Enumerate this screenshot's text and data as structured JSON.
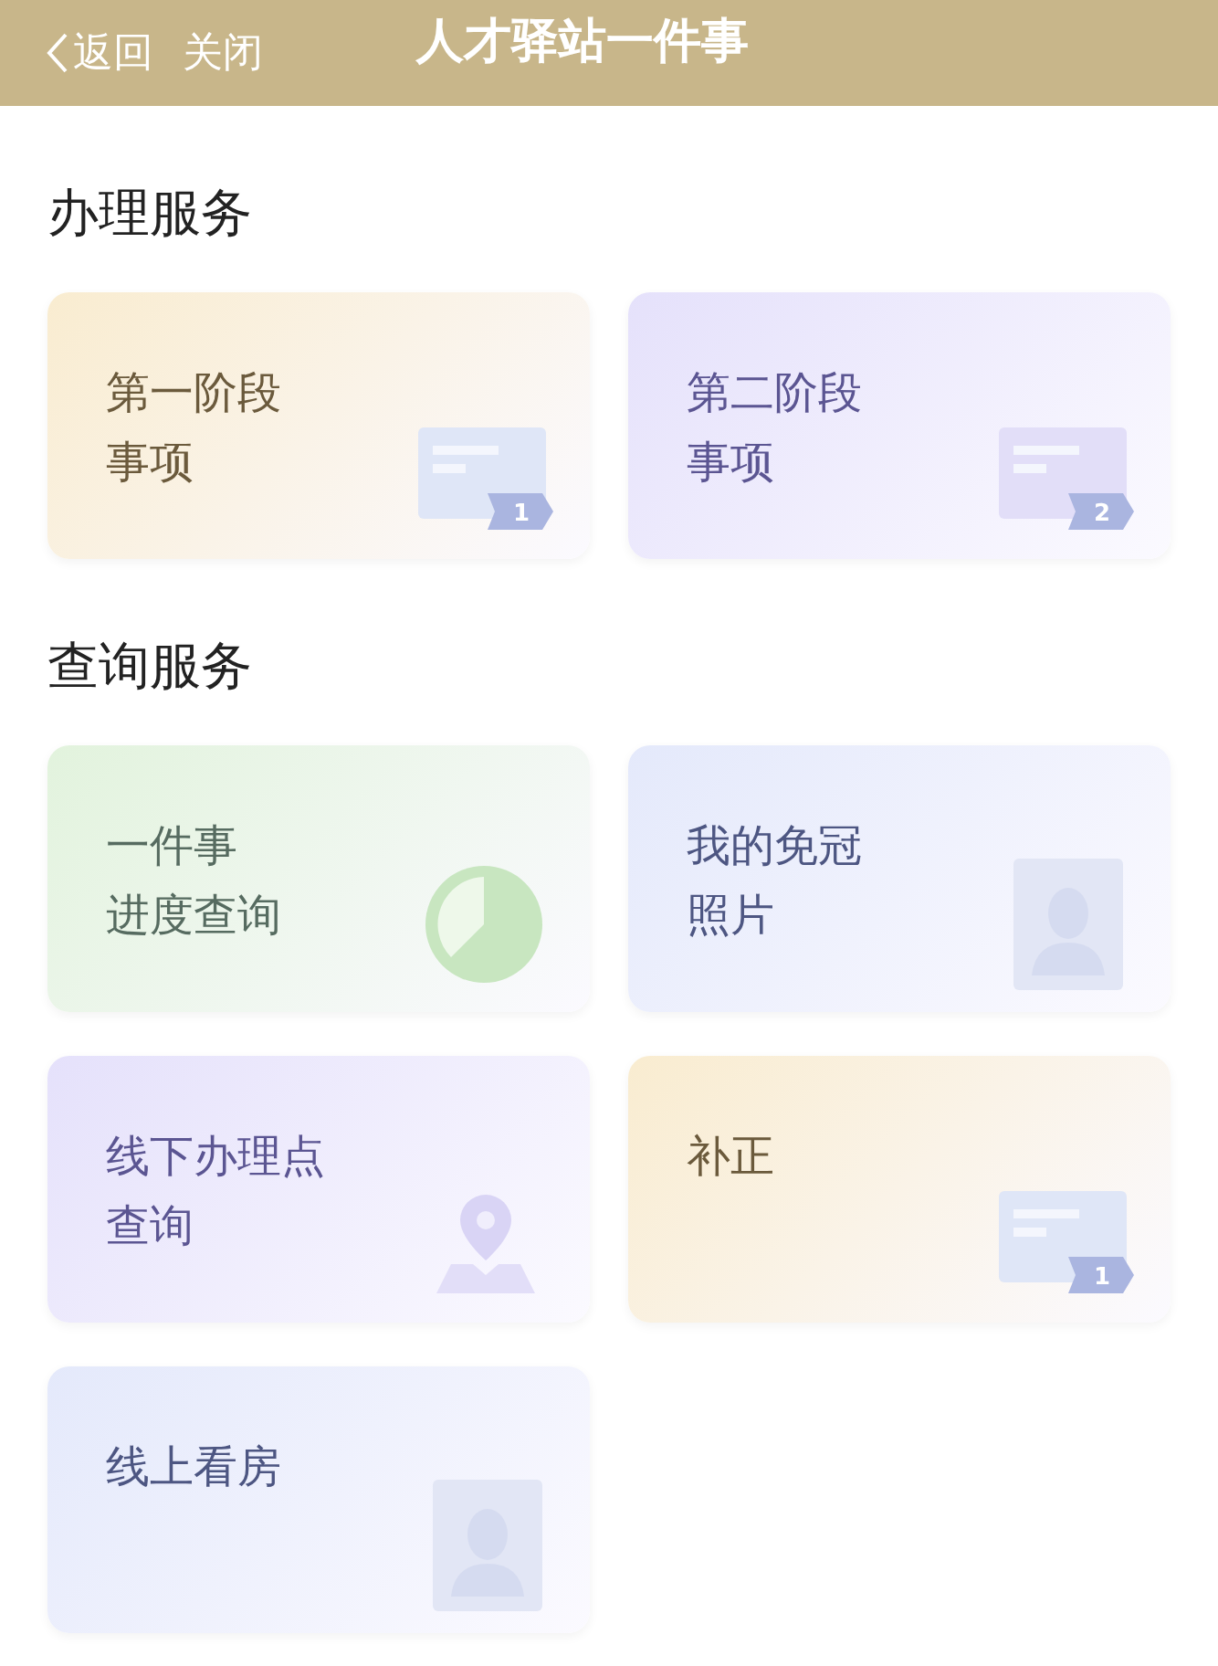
{
  "nav_bar": {
    "back": "返回",
    "close": "关闭",
    "title": "人才驿站一件事"
  },
  "sections": [
    {
      "title": "办理服务",
      "cards": [
        {
          "lines": [
            "第一阶段",
            "事项"
          ],
          "color": "#f9ecd0",
          "kind": "form",
          "icon_number": "1"
        },
        {
          "lines": [
            "第二阶段",
            "事项"
          ],
          "color": "#e5e1fb",
          "kind": "form",
          "icon_number": "2"
        }
      ]
    },
    {
      "title": "查询服务",
      "cards": [
        {
          "lines": [
            "一件事",
            "进度查询"
          ],
          "color": "#e2f3dd",
          "kind": "progress"
        },
        {
          "lines": [
            "我的免冠",
            "照片"
          ],
          "color": "#e4e9fb",
          "kind": "photo"
        },
        {
          "lines": [
            "线下办理点",
            "查询"
          ],
          "color": "#e5e1fb",
          "kind": "location"
        },
        {
          "lines": [
            "补正"
          ],
          "color": "#f9ecd0",
          "kind": "form",
          "icon_number": "1"
        },
        {
          "lines": [
            "线上看房"
          ],
          "color": "#e4e9fb",
          "kind": "photo"
        }
      ]
    }
  ]
}
